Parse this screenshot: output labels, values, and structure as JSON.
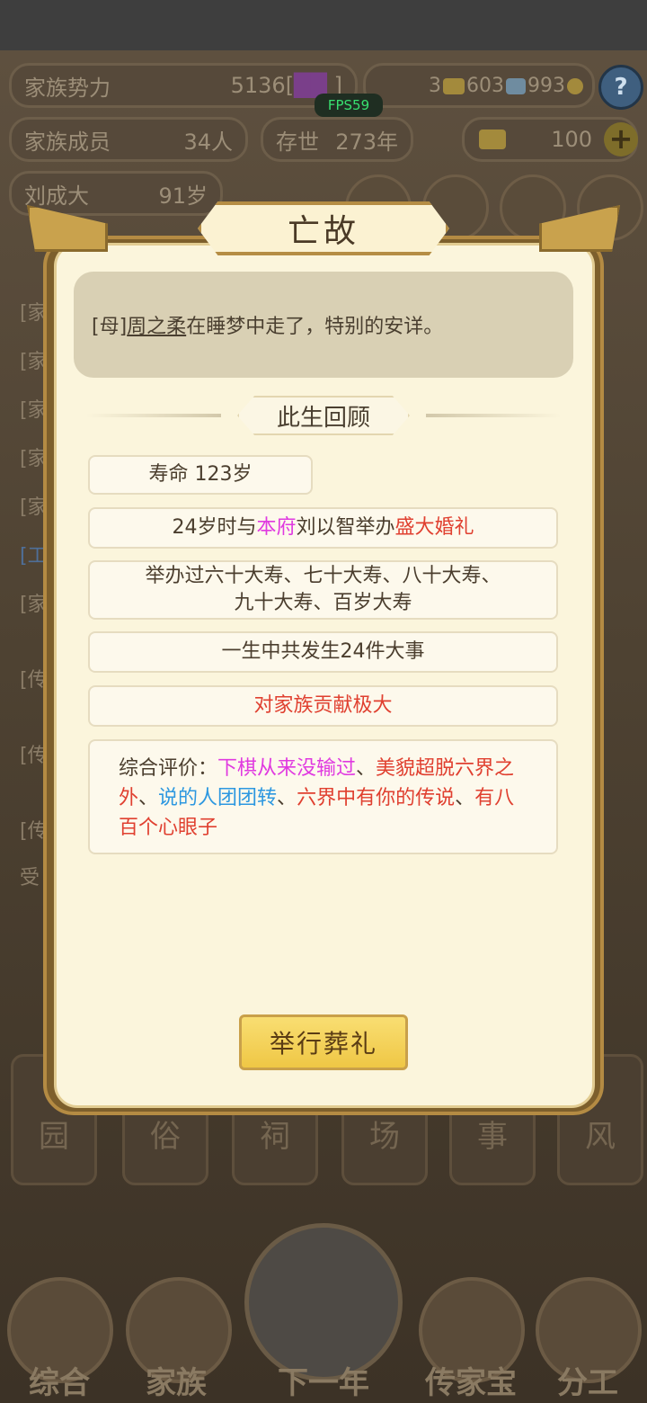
{
  "topbar": {
    "family_power_label": "家族势力",
    "family_power_value": "5136",
    "family_power_grade": "[",
    "family_power_grade_end": "]",
    "currency_a": "3",
    "currency_b": "603",
    "currency_c": "993",
    "help": "?",
    "fps": "FPS59",
    "members_label": "家族成员",
    "members_value": "34人",
    "existence_label": "存世",
    "existence_value": "273年",
    "gold_value": "100",
    "plus": "+",
    "patriarch_name": "刘成大",
    "patriarch_age": "91岁"
  },
  "background_list": [
    "[家",
    "[家",
    "[家",
    "[家",
    "[家",
    "[工",
    "[家",
    "[传",
    "[传",
    "[传",
    "受"
  ],
  "nav_tiles": [
    "园",
    "俗",
    "祠",
    "场",
    "事",
    "风"
  ],
  "bottom_nav": {
    "items": [
      "综合",
      "家族",
      "下一年",
      "传家宝",
      "分工"
    ]
  },
  "dialog": {
    "title": "亡故",
    "message_prefix": "[母]",
    "message_name": "周之柔",
    "message_rest": "在睡梦中走了，特别的安详。",
    "section_title": "此生回顾",
    "lifespan": "寿命 123岁",
    "marriage": {
      "part1": "24岁时与",
      "part2": "本府",
      "part3": "刘以智举办",
      "part4": "盛大婚礼"
    },
    "birthdays_line1": "举办过六十大寿、七十大寿、八十大寿、",
    "birthdays_line2": "九十大寿、百岁大寿",
    "events": "一生中共发生24件大事",
    "contribution": "对家族贡献极大",
    "evaluation": {
      "label": "综合评价：",
      "t1": "下棋从来没输过",
      "sep1": "、",
      "t2": "美貌超脱六界之外",
      "sep2": "、",
      "t3": "说的人团团转",
      "sep3": "、",
      "t4": "六界中有你的传说",
      "sep4": "、",
      "t5": "有八百个心眼子"
    },
    "funeral_button": "举行葬礼"
  },
  "colors": {
    "pink": "#e03ae0",
    "red": "#e04030",
    "blue": "#2d98e0",
    "button_gold": "#efc745"
  }
}
